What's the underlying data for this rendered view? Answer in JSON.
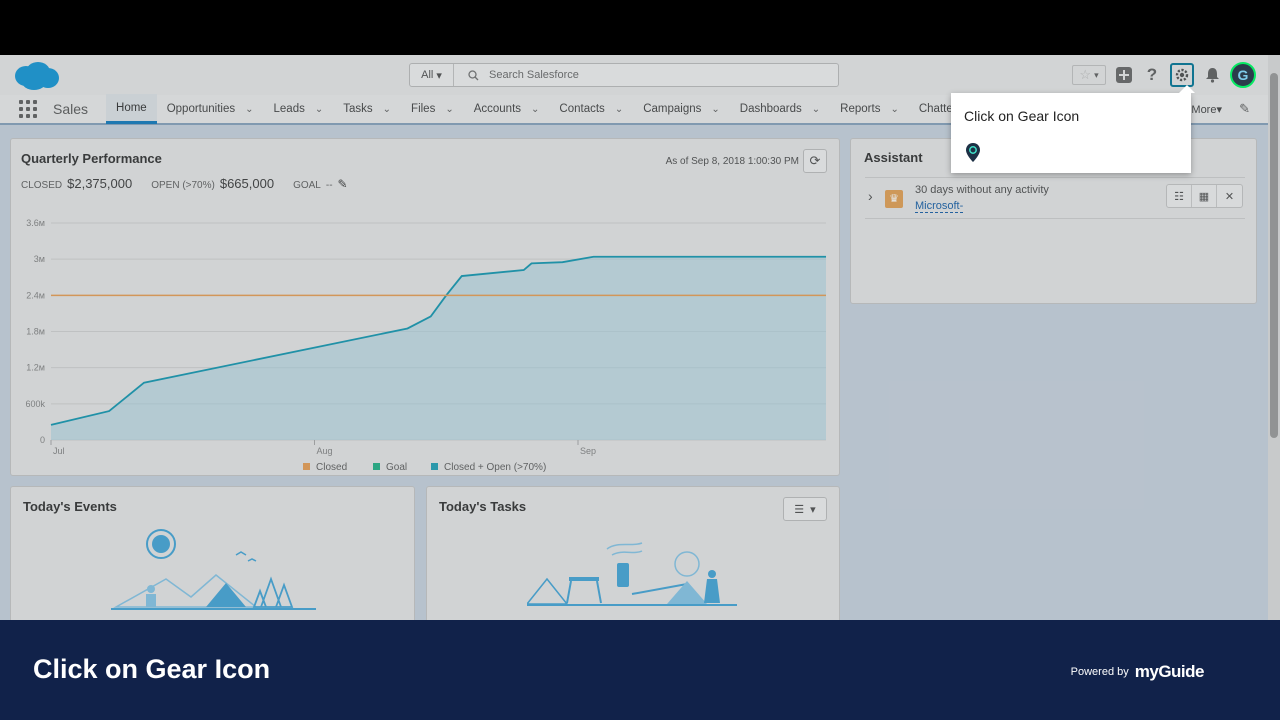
{
  "search": {
    "scope": "All",
    "placeholder": "Search Salesforce"
  },
  "nav": {
    "app_name": "Sales",
    "items": [
      {
        "label": "Home"
      },
      {
        "label": "Opportunities"
      },
      {
        "label": "Leads"
      },
      {
        "label": "Tasks"
      },
      {
        "label": "Files"
      },
      {
        "label": "Accounts"
      },
      {
        "label": "Contacts"
      },
      {
        "label": "Campaigns"
      },
      {
        "label": "Dashboards"
      },
      {
        "label": "Reports"
      },
      {
        "label": "Chatter"
      }
    ],
    "more": "More"
  },
  "user": {
    "avatar_letter": "G"
  },
  "performance": {
    "title": "Quarterly Performance",
    "closed_label": "CLOSED",
    "closed_value": "$2,375,000",
    "open_label": "OPEN (>70%)",
    "open_value": "$665,000",
    "goal_label": "GOAL",
    "goal_value": "--",
    "as_of": "As of Sep 8, 2018 1:00:30 PM"
  },
  "chart_data": {
    "type": "line",
    "title": "",
    "x_ticks": [
      "Jul",
      "Aug",
      "Sep"
    ],
    "y_ticks": [
      "0",
      "600k",
      "1.2м",
      "1.8м",
      "2.4м",
      "3м",
      "3.6м"
    ],
    "ylim": [
      0,
      3600000
    ],
    "legend": [
      "Closed",
      "Goal",
      "Closed + Open (>70%)"
    ],
    "legend_colors": [
      "#e8a15a",
      "#2bb38a",
      "#2aa3b8"
    ],
    "goal_value": 2400000,
    "series": [
      {
        "name": "Closed + Open (>70%)",
        "points": [
          [
            0.0,
            250000
          ],
          [
            0.075,
            480000
          ],
          [
            0.12,
            950000
          ],
          [
            0.46,
            1850000
          ],
          [
            0.49,
            2050000
          ],
          [
            0.51,
            2400000
          ],
          [
            0.53,
            2720000
          ],
          [
            0.61,
            2820000
          ],
          [
            0.62,
            2930000
          ],
          [
            0.66,
            2950000
          ],
          [
            0.7,
            3040000
          ],
          [
            1.0,
            3040000
          ]
        ]
      }
    ]
  },
  "assistant": {
    "title": "Assistant",
    "item_text": "30 days without any activity",
    "item_link": "Microsoft-"
  },
  "events": {
    "title": "Today's Events"
  },
  "tasks": {
    "title": "Today's Tasks"
  },
  "tooltip": {
    "text": "Click on Gear Icon"
  },
  "banner": {
    "text": "Click on Gear Icon",
    "powered_by": "Powered by",
    "brand": "myGuide"
  }
}
